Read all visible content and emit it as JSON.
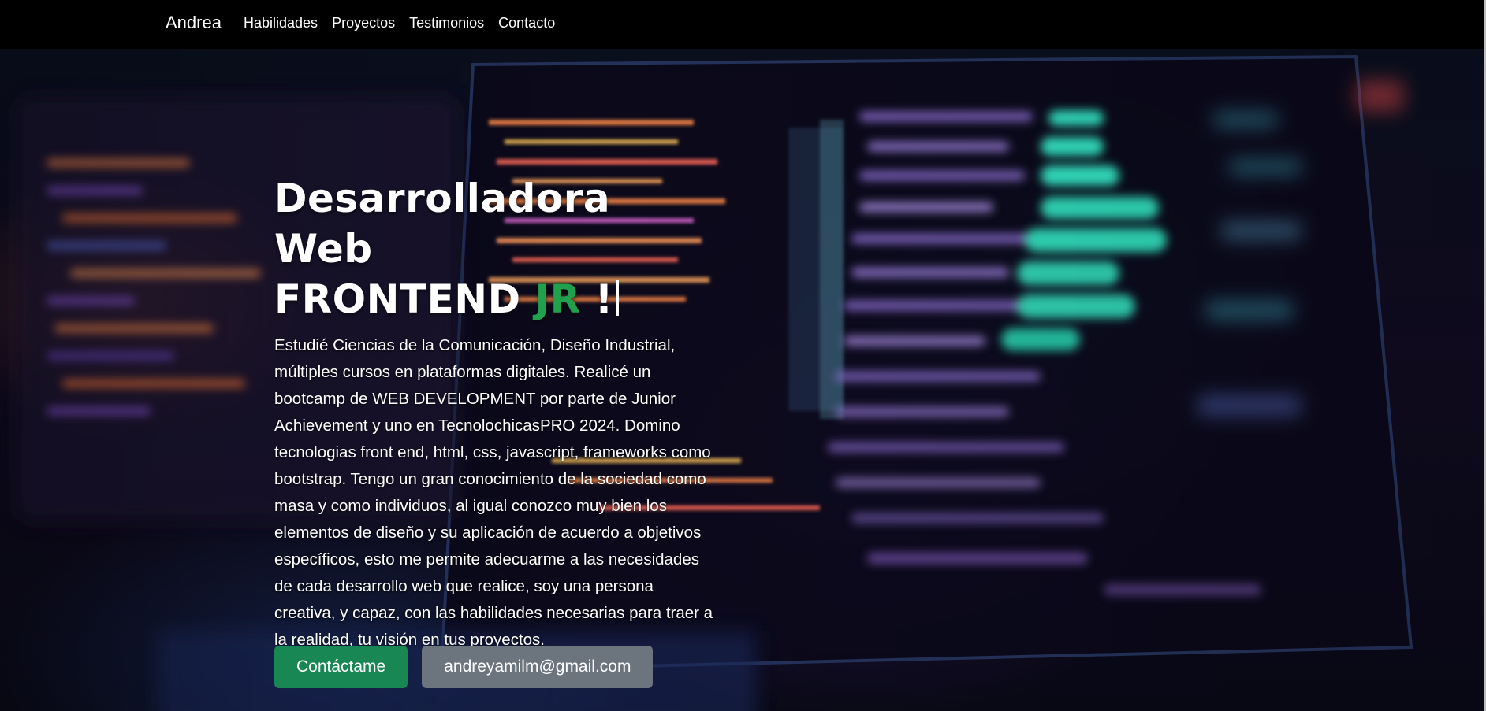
{
  "navbar": {
    "brand": "Andrea",
    "links": [
      "Habilidades",
      "Proyectos",
      "Testimonios",
      "Contacto"
    ]
  },
  "hero": {
    "title_line1": "Desarrolladora Web",
    "title_line2_main": "FRONTEND",
    "title_line2_accent": "JR",
    "title_line2_end": "!",
    "description": "Estudié Ciencias de la Comunicación, Diseño Industrial, múltiples cursos en plataformas digitales. Realicé un bootcamp de WEB DEVELOPMENT por parte de Junior Achievement y uno en TecnolochicasPRO 2024. Domino tecnologias front end, html, css, javascript, frameworks como bootstrap. Tengo un gran conocimiento de la sociedad como masa y como individuos, al igual conozco muy bien los elementos de diseño y su aplicación de acuerdo a objetivos específicos, esto me permite adecuarme a las necesidades de cada desarrollo web que realice, soy una persona creativa, y capaz, con las habilidades necesarias para traer a la realidad, tu visión en tus proyectos.",
    "primary_button": "Contáctame",
    "secondary_button": "andreyamilm@gmail.com"
  },
  "colors": {
    "navbar_bg": "#000000",
    "accent_green": "#21a04d",
    "button_green": "#198754",
    "button_gray": "#6c757d"
  }
}
